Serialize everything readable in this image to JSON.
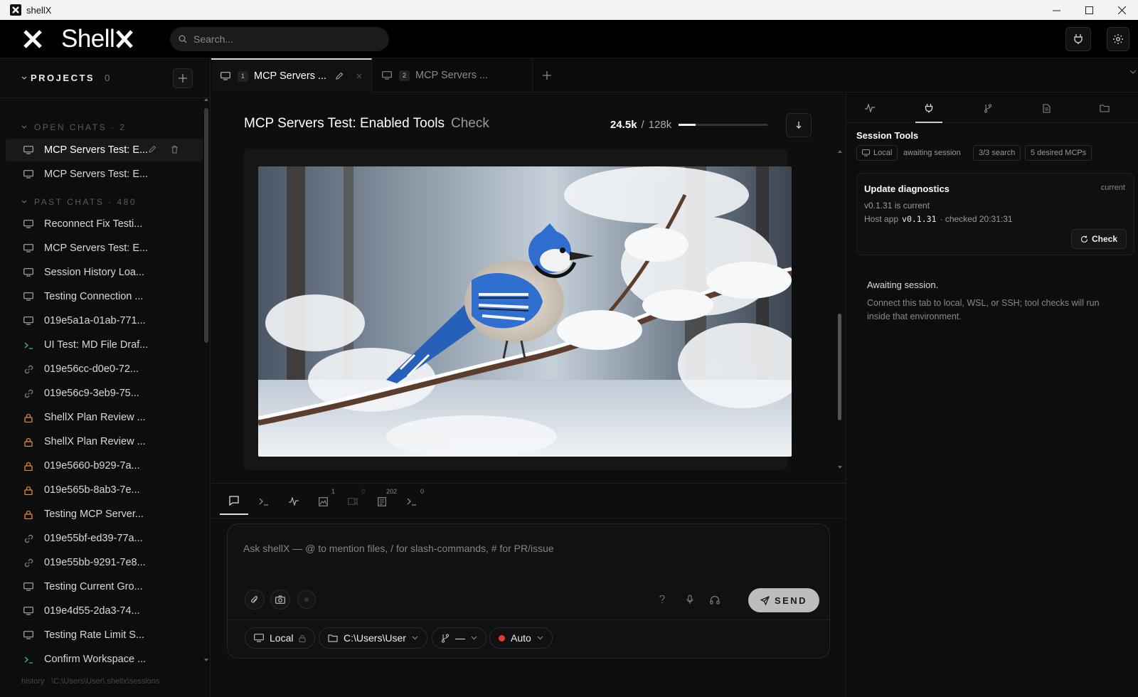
{
  "window": {
    "title": "shellX"
  },
  "app": {
    "logo_text": "Shell",
    "search_placeholder": "Search..."
  },
  "sidebar": {
    "projects_label": "PROJECTS",
    "projects_count": "0",
    "open_chats_label": "OPEN CHATS · 2",
    "past_chats_label": "PAST CHATS · 480",
    "open_chats": [
      {
        "title": "MCP Servers Test: E...",
        "icon": "monitor-icon",
        "active": true
      },
      {
        "title": "MCP Servers Test: E...",
        "icon": "monitor-icon"
      }
    ],
    "past_chats": [
      {
        "title": "Reconnect Fix Testi...",
        "icon": "monitor-icon"
      },
      {
        "title": "MCP Servers Test: E...",
        "icon": "monitor-icon"
      },
      {
        "title": "Session History Loa...",
        "icon": "monitor-icon"
      },
      {
        "title": "Testing Connection ...",
        "icon": "monitor-icon"
      },
      {
        "title": "019e5a1a-01ab-771...",
        "icon": "monitor-icon"
      },
      {
        "title": "UI Test: MD File Draf...",
        "icon": "terminal-icon"
      },
      {
        "title": "019e56cc-d0e0-72...",
        "icon": "link-icon"
      },
      {
        "title": "019e56c9-3eb9-75...",
        "icon": "link-icon"
      },
      {
        "title": "ShellX Plan Review ...",
        "icon": "lock-icon"
      },
      {
        "title": "ShellX Plan Review ...",
        "icon": "lock-icon"
      },
      {
        "title": "019e5660-b929-7a...",
        "icon": "lock-icon"
      },
      {
        "title": "019e565b-8ab3-7e...",
        "icon": "lock-icon"
      },
      {
        "title": "Testing MCP Server...",
        "icon": "lock-icon"
      },
      {
        "title": "019e55bf-ed39-77a...",
        "icon": "link-icon"
      },
      {
        "title": "019e55bb-9291-7e8...",
        "icon": "link-icon"
      },
      {
        "title": "Testing Current Gro...",
        "icon": "monitor-icon"
      },
      {
        "title": "019e4d55-2da3-74...",
        "icon": "monitor-icon"
      },
      {
        "title": "Testing Rate Limit S...",
        "icon": "monitor-icon"
      },
      {
        "title": "Confirm Workspace ...",
        "icon": "terminal-icon"
      }
    ],
    "footer": "history · \\C:\\Users\\User\\.shellx\\sessions"
  },
  "tabs": [
    {
      "num": "1",
      "label": "MCP Servers ...",
      "active": true
    },
    {
      "num": "2",
      "label": "MCP Servers ...",
      "active": false
    }
  ],
  "chat": {
    "title": "MCP Servers Test: Enabled Tools",
    "title_suffix": "Check",
    "tokens_used": "24.5k",
    "tokens_sep": "/",
    "tokens_total": "128k",
    "tokens_fraction": 0.19
  },
  "composer": {
    "tool_badges": {
      "image": "1",
      "video": "0",
      "files": "202",
      "terminal": "0"
    },
    "placeholder": "Ask shellX — @ to mention files, / for slash-commands, # for PR/issue",
    "send_label": "SEND",
    "env": "Local",
    "path": "C:\\Users\\User",
    "branch": "—",
    "mode": "Auto"
  },
  "right_panel": {
    "section_title": "Session Tools",
    "chips": [
      "Local",
      "awaiting session",
      "3/3 search",
      "5 desired MCPs"
    ],
    "diagnostics": {
      "title": "Update diagnostics",
      "status": "current",
      "line1": "v0.1.31 is current",
      "host_label": "Host app",
      "host_version": "v0.1.31",
      "checked": "· checked 20:31:31",
      "check_label": "Check"
    },
    "await_title": "Awaiting session.",
    "await_desc": "Connect this tab to local, WSL, or SSH; tool checks will run inside that environment."
  }
}
